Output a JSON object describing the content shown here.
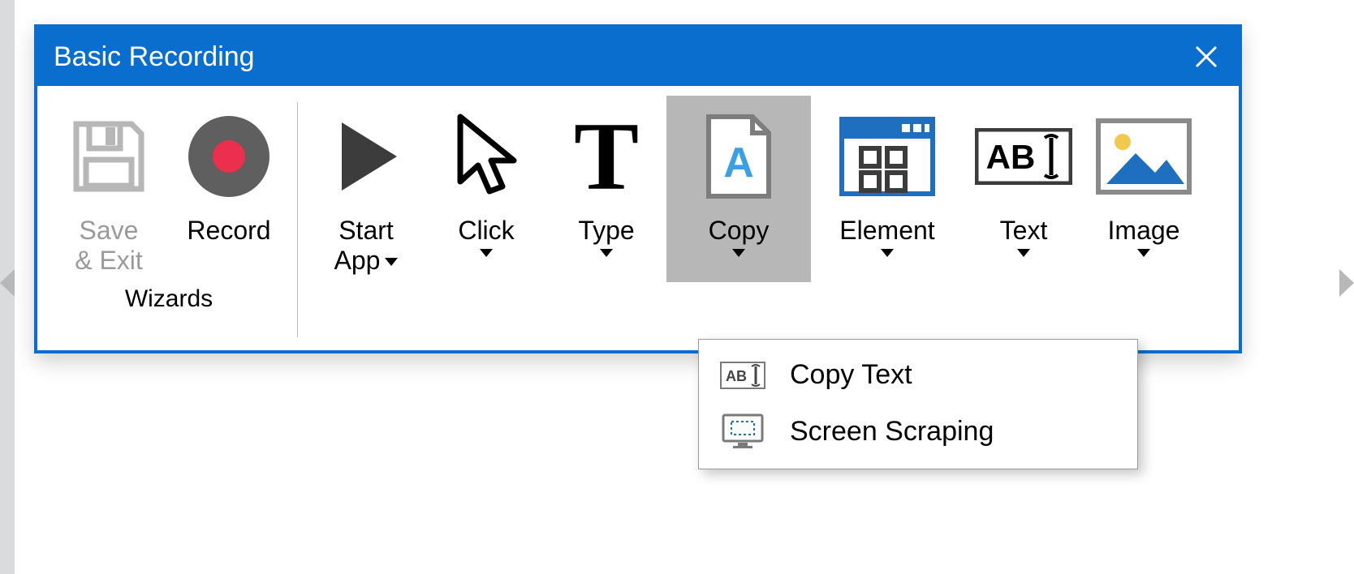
{
  "window": {
    "title": "Basic Recording"
  },
  "groups": {
    "wizards": {
      "label": "Wizards"
    }
  },
  "toolbar": {
    "save_exit": {
      "line1": "Save",
      "line2": "& Exit",
      "enabled": false,
      "has_dropdown": false
    },
    "record": {
      "line1": "Record",
      "enabled": true,
      "has_dropdown": false
    },
    "start_app": {
      "line1": "Start",
      "line2": "App",
      "enabled": true,
      "has_dropdown": true
    },
    "click": {
      "line1": "Click",
      "enabled": true,
      "has_dropdown": true
    },
    "type": {
      "line1": "Type",
      "enabled": true,
      "has_dropdown": true
    },
    "copy": {
      "line1": "Copy",
      "enabled": true,
      "has_dropdown": true,
      "pressed": true
    },
    "element": {
      "line1": "Element",
      "enabled": true,
      "has_dropdown": true
    },
    "text": {
      "line1": "Text",
      "enabled": true,
      "has_dropdown": true
    },
    "image": {
      "line1": "Image",
      "enabled": true,
      "has_dropdown": true
    }
  },
  "copy_menu": {
    "items": [
      {
        "icon": "text-ab-icon",
        "label": "Copy Text"
      },
      {
        "icon": "screen-scraping-icon",
        "label": "Screen Scraping"
      }
    ]
  }
}
